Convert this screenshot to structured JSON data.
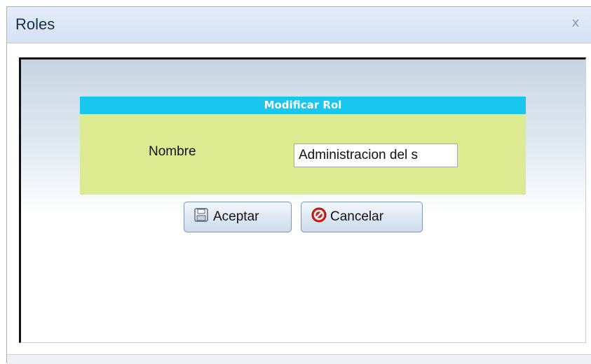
{
  "window": {
    "title": "Roles",
    "close_label": "x"
  },
  "form": {
    "header": "Modificar Rol",
    "field_label": "Nombre",
    "field_value": "Administracion del s"
  },
  "buttons": {
    "accept_label": "Aceptar",
    "accept_icon": "save-icon",
    "cancel_label": "Cancelar",
    "cancel_icon": "cancel-icon"
  },
  "colors": {
    "header_bg": "#19c6ee",
    "form_bg": "#dceb8f",
    "title_bar": "#d5e2f2"
  }
}
